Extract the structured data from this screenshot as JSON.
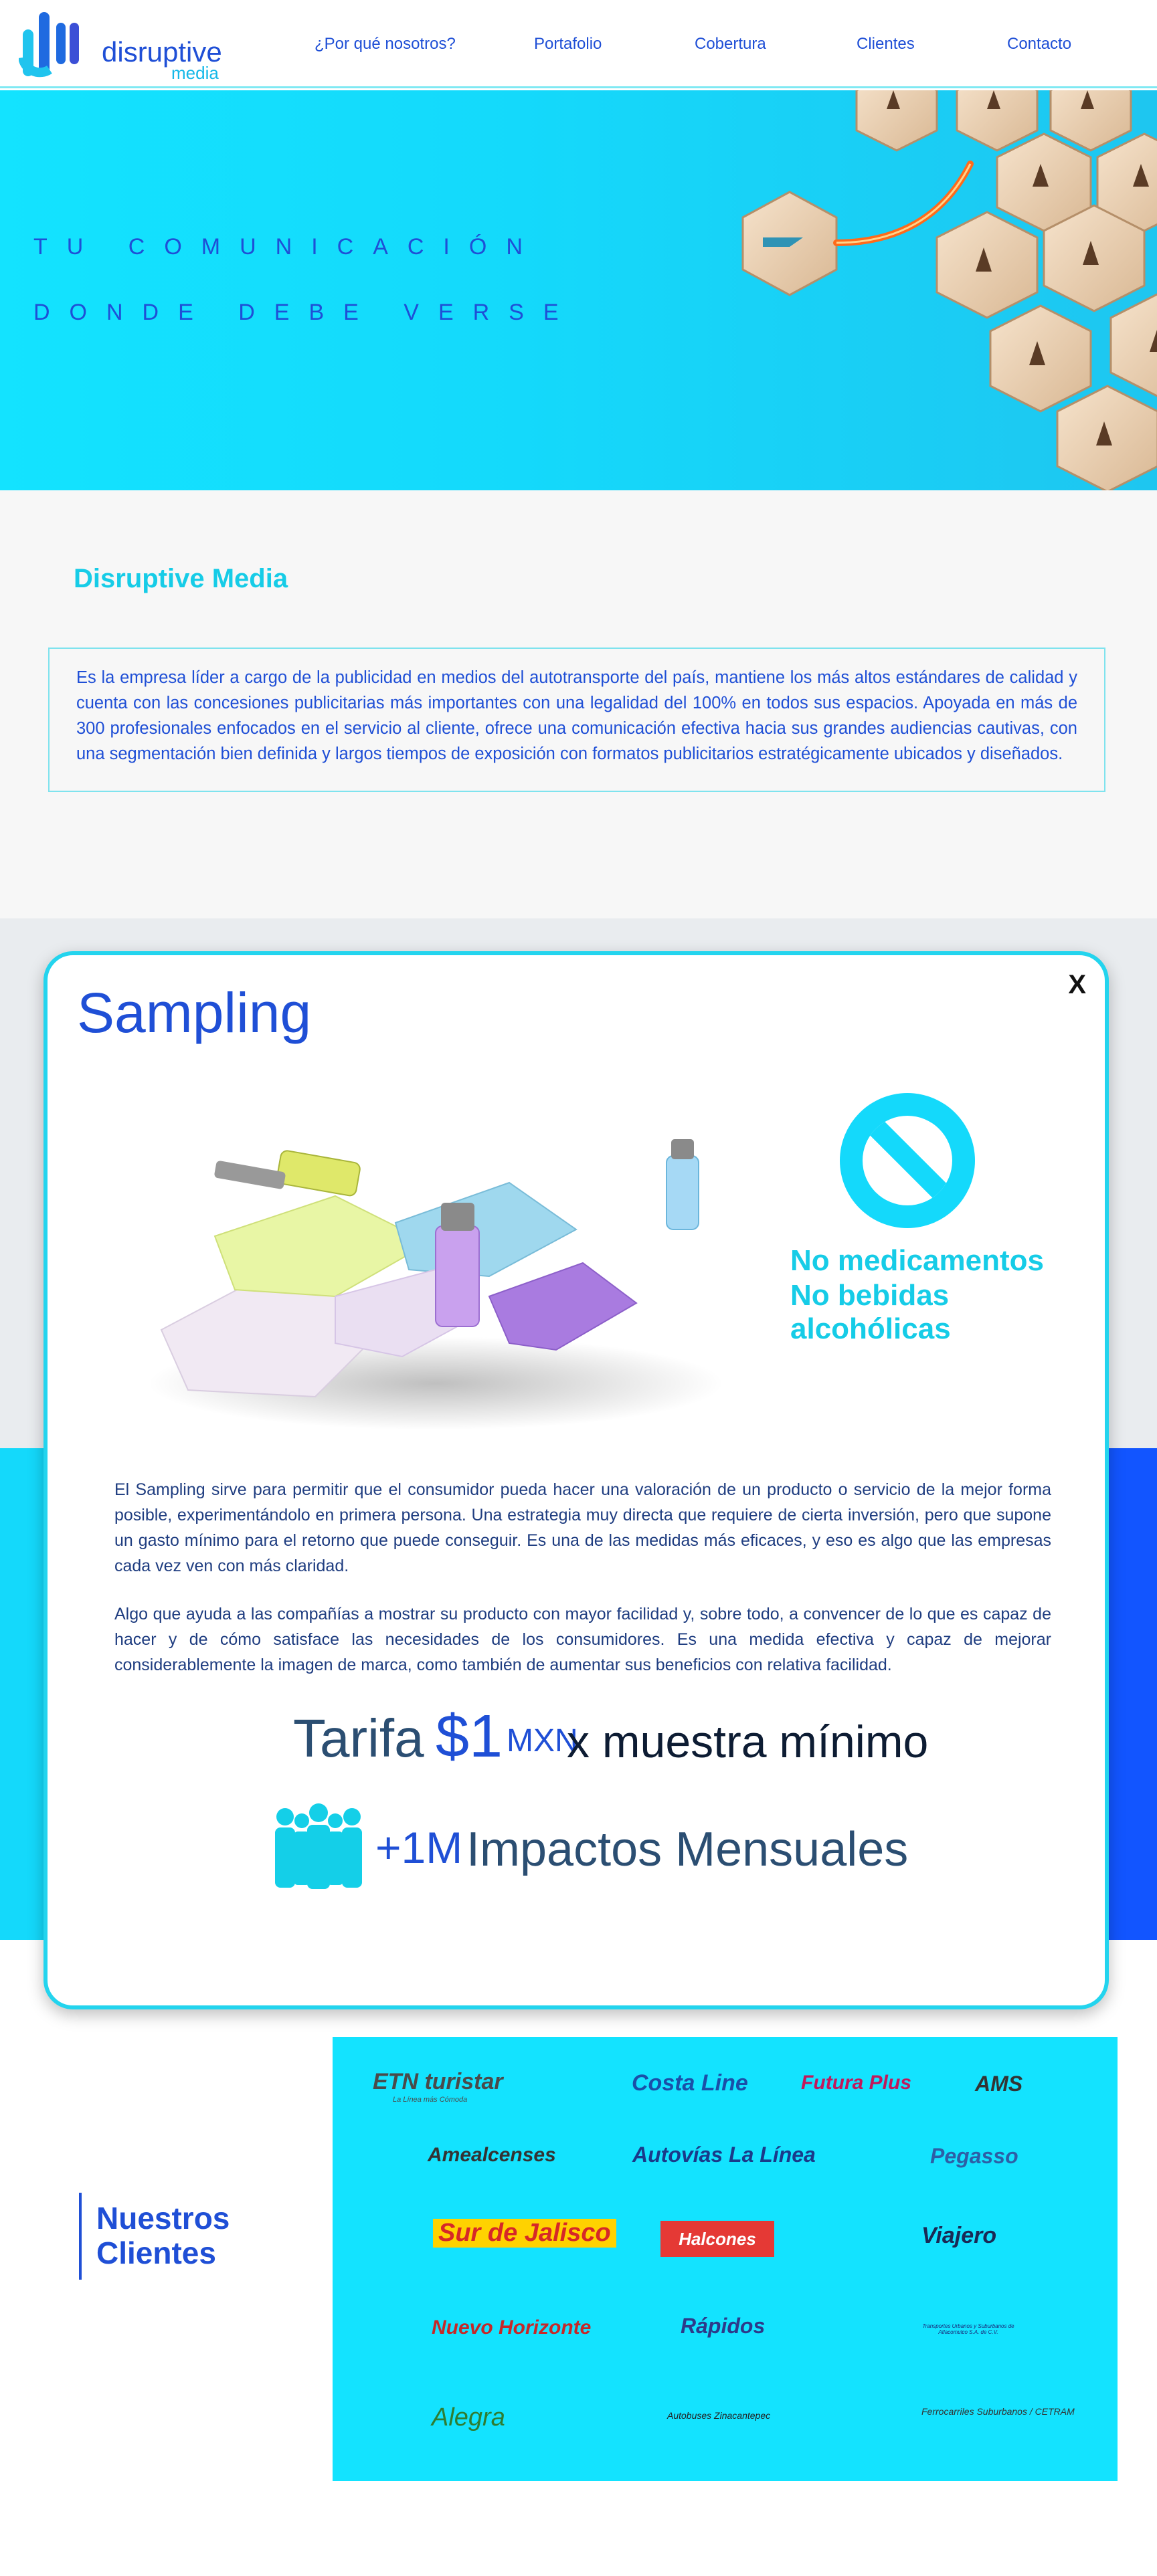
{
  "header": {
    "logo": {
      "main": "disruptive",
      "sub": "media"
    },
    "nav": [
      {
        "label": "¿Por qué nosotros?"
      },
      {
        "label": "Portafolio"
      },
      {
        "label": "Cobertura"
      },
      {
        "label": "Clientes"
      },
      {
        "label": "Contacto"
      }
    ]
  },
  "hero": {
    "line1": "TU COMUNICACIÓN",
    "line2": "DONDE DEBE VERSE"
  },
  "intro": {
    "title": "Disruptive Media",
    "body": "Es la empresa líder a cargo de la publicidad en medios del autotransporte del país, mantiene los más altos estándares de calidad y cuenta con las concesiones publicitarias más importantes con una legalidad del 100% en todos sus espacios. Apoyada en más de 300 profesionales enfocados en el servicio al cliente, ofrece una comunicación efectiva hacia sus grandes audiencias cautivas, con una segmentación bien definida y largos tiempos de exposición con formatos publicitarios estratégicamente ubicados y diseñados."
  },
  "modal": {
    "close_label": "X",
    "title": "Sampling",
    "restrictions": [
      "No medicamentos",
      "No bebidas alcohólicas"
    ],
    "paragraph1": "El Sampling sirve para permitir que el consumidor pueda hacer una valoración de un producto o servicio de la mejor forma posible, experimentándolo en primera persona. Una estrategia muy directa que requiere de cierta inversión, pero que supone un gasto mínimo para el retorno que puede conseguir. Es una de las medidas más eficaces, y eso es algo que las empresas cada vez ven con más claridad.",
    "paragraph2": "Algo que ayuda a las compañías a mostrar su producto con mayor facilidad y, sobre todo, a convencer de lo que es capaz de hacer y de cómo satisface las necesidades de los consumidores. Es una medida efectiva y capaz de mejorar considerablemente la imagen de marca, como también de aumentar sus beneficios con relativa facilidad.",
    "tarifa_label": "Tarifa",
    "tarifa_price": "$1",
    "tarifa_currency": "MXN",
    "tarifa_rest": "x muestra mínimo",
    "impacts_number": "+1M",
    "impacts_label": "Impactos Mensuales"
  },
  "clients": {
    "title_line1": "Nuestros",
    "title_line2": "Clientes",
    "logos": [
      {
        "name": "ETN turistar",
        "tagline": "La Línea más Cómoda",
        "color": "#4a4a4a"
      },
      {
        "name": "Costa Line",
        "color": "#1a4fa8"
      },
      {
        "name": "Futura Plus",
        "color": "#c2185b"
      },
      {
        "name": "AMS",
        "color": "#333333"
      },
      {
        "name": "Amealcenses",
        "color": "#333333"
      },
      {
        "name": "Autovías La Línea",
        "color": "#1a3a8a"
      },
      {
        "name": "Pegasso",
        "color": "#2d5fa6"
      },
      {
        "name": "Sur de Jalisco",
        "color": "#d62828"
      },
      {
        "name": "Halcones",
        "color": "#ffffff"
      },
      {
        "name": "Viajero",
        "color": "#1a2a55"
      },
      {
        "name": "Nuevo Horizonte",
        "color": "#c62828"
      },
      {
        "name": "Rápidos",
        "color": "#2d3a8a"
      },
      {
        "name": "Transportes Urbanos y Suburbanos de Atlacomulco S.A. de C.V.",
        "color": "#1a2a7a"
      },
      {
        "name": "Alegra",
        "color": "#2e7d32"
      },
      {
        "name": "Autobuses Zinacantepec",
        "color": "#222222"
      },
      {
        "name": "Ferrocarriles Suburbanos / CETRAM",
        "color": "#333333"
      }
    ]
  }
}
